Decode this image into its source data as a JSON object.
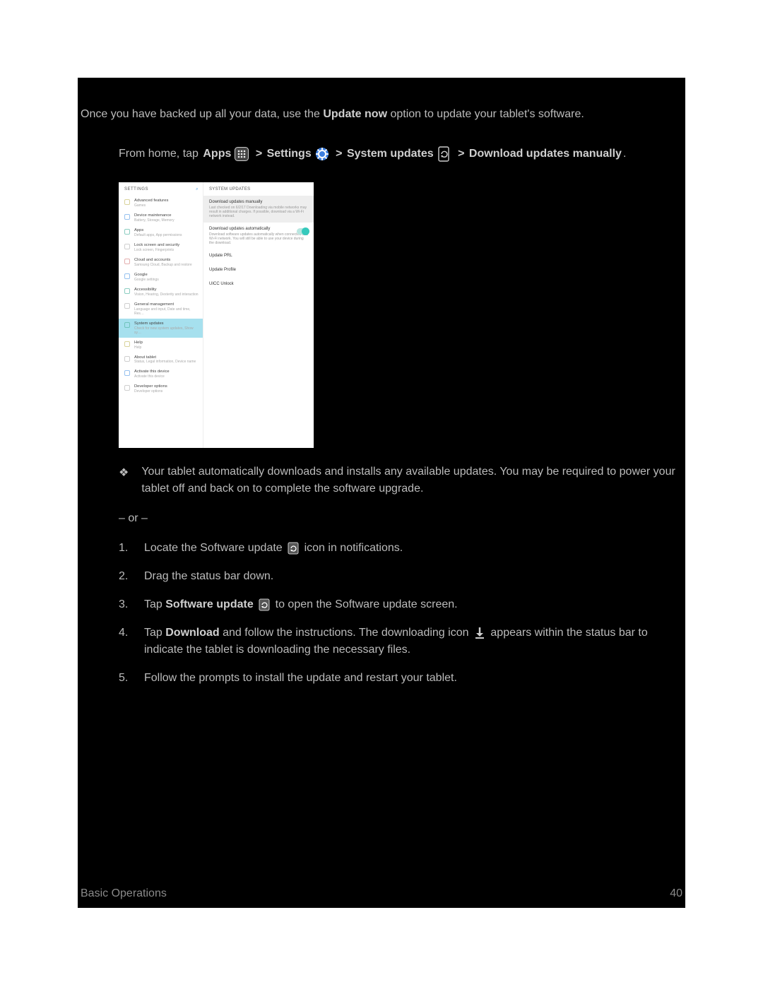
{
  "intro": {
    "pre": "Once you have backed up all your data, use the ",
    "bold": "Update now",
    "post": " option to update your tablet's software."
  },
  "nav": {
    "from_home_tap": "From home, tap ",
    "apps": "Apps",
    "settings": "Settings",
    "system_updates": "System updates",
    "download_updates_manually": "Download updates manually",
    "separator": " > ",
    "period": "."
  },
  "screenshot": {
    "left_header": "SETTINGS",
    "right_header": "SYSTEM UPDATES",
    "left_items": [
      {
        "t1": "Advanced features",
        "t2": "Games",
        "dot": "yellow"
      },
      {
        "t1": "Device maintenance",
        "t2": "Battery, Storage, Memory",
        "dot": "blue"
      },
      {
        "t1": "Apps",
        "t2": "Default apps, App permissions",
        "dot": "teal"
      },
      {
        "t1": "Lock screen and security",
        "t2": "Lock screen, Fingerprints",
        "dot": "gray"
      },
      {
        "t1": "Cloud and accounts",
        "t2": "Samsung Cloud, Backup and restore",
        "dot": "red"
      },
      {
        "t1": "Google",
        "t2": "Google settings",
        "dot": "blue"
      },
      {
        "t1": "Accessibility",
        "t2": "Vision, Hearing, Dexterity and interaction",
        "dot": "teal"
      },
      {
        "t1": "General management",
        "t2": "Language and input, Date and time, Res…",
        "dot": "gray"
      },
      {
        "t1": "System updates",
        "t2": "Check for new system updates, Show sy…",
        "dot": "teal",
        "selected": true
      },
      {
        "t1": "Help",
        "t2": "Help",
        "dot": "yellow"
      },
      {
        "t1": "About tablet",
        "t2": "Status, Legal information, Device name",
        "dot": "gray"
      },
      {
        "t1": "Activate this device",
        "t2": "Activate this device",
        "dot": "blue"
      },
      {
        "t1": "Developer options",
        "t2": "Developer options",
        "dot": "gray"
      }
    ],
    "right_items": [
      {
        "rt1": "Download updates manually",
        "rt2": "Last checked on 6/2/17\nDownloading via mobile networks may result in additional charges. If possible, download via a Wi-Fi network instead.",
        "hi": true
      },
      {
        "rt1": "Download updates automatically",
        "rt2": "Download software updates automatically when connected to a Wi-Fi network. You will still be able to use your device during the download.",
        "toggle": true
      },
      {
        "rt1": "Update PRL"
      },
      {
        "rt1": "Update Profile"
      },
      {
        "rt1": "UICC Unlock"
      }
    ]
  },
  "bullet": "Your tablet automatically downloads and installs any available updates. You may be required to power your tablet off and back on to complete the software upgrade.",
  "or": "– or –",
  "steps": {
    "s1_pre": "Locate the Software update ",
    "s1_post": " icon in notifications.",
    "s2": "Drag the status bar down.",
    "s3_pre": "Tap ",
    "s3_bold": "Software update",
    "s3_mid": " ",
    "s3_post": " to open the Software update screen.",
    "s4_pre": "Tap ",
    "s4_bold": "Download",
    "s4_mid": " and follow the instructions. The downloading icon ",
    "s4_post": " appears within the status bar to indicate the tablet is downloading the necessary files.",
    "s5": "Follow the prompts to install the update and restart your tablet."
  },
  "footer": {
    "left": "Basic Operations",
    "right": "40"
  }
}
